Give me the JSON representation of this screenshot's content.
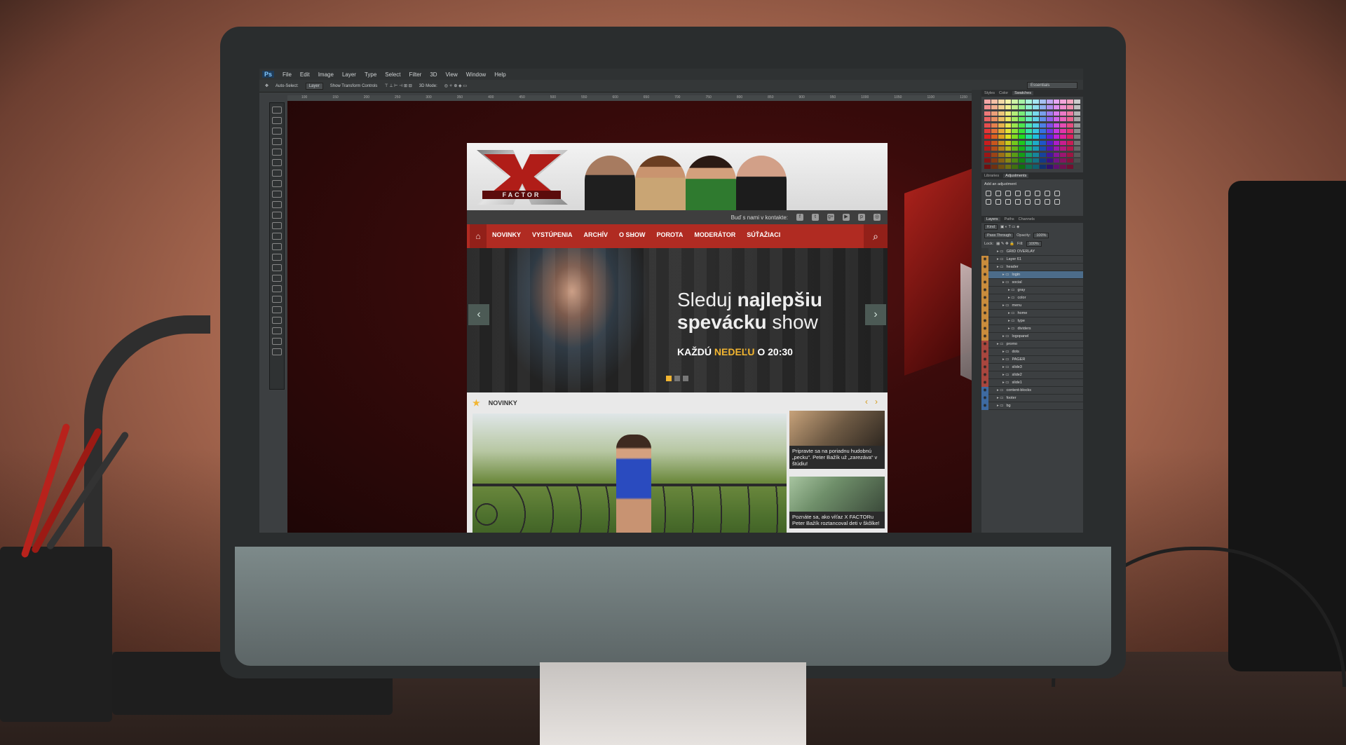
{
  "photoshop": {
    "logo": "Ps",
    "menu": [
      "File",
      "Edit",
      "Image",
      "Layer",
      "Type",
      "Select",
      "Filter",
      "3D",
      "View",
      "Window",
      "Help"
    ],
    "options": {
      "auto_select_label": "Auto-Select:",
      "auto_select_value": "Layer",
      "transform_label": "Show Transform Controls",
      "mode_label": "3D Mode:",
      "workspace": "Essentials"
    },
    "ruler_ticks": [
      "100",
      "150",
      "200",
      "250",
      "300",
      "350",
      "400",
      "450",
      "500",
      "550",
      "600",
      "650",
      "700",
      "750",
      "800",
      "850",
      "900",
      "950",
      "1000",
      "1050",
      "1100",
      "1150"
    ]
  },
  "website": {
    "logo_text": "FACTOR",
    "social_label": "Buď s nami v kontakte:",
    "social_icons": [
      "f",
      "t",
      "g+",
      "▶",
      "p",
      "◎"
    ],
    "nav": [
      "NOVINKY",
      "VYSTÚPENIA",
      "ARCHÍV",
      "O SHOW",
      "POROTA",
      "MODERÁTOR",
      "SÚŤAŽIACI"
    ],
    "hero": {
      "line1_normal": "Sleduj",
      "line1_bold": "najlepšiu",
      "line2_bold": "spevácku",
      "line2_normal": "show",
      "sub_prefix": "KAŽDÚ",
      "sub_highlight": "NEDEĽU",
      "sub_suffix": "O 20:30"
    },
    "news": {
      "title": "NOVINKY",
      "items": [
        {
          "text": "Pripravte sa na poriadnu hudobnú „pecku“. Peter Bažík už „zarezáva“ v štúdiu!"
        },
        {
          "text": "Poznáte sa, ako víťaz X FACTORu Peter Bažík roztancoval deti v škôlke!"
        }
      ]
    }
  },
  "panels": {
    "top_tabs": [
      "Styles",
      "Color",
      "Swatches"
    ],
    "mid_tabs": [
      "Libraries",
      "Adjustments"
    ],
    "adjustments_title": "Add an adjustment",
    "layer_tabs": [
      "Layers",
      "Paths",
      "Channels"
    ],
    "kind_label": "Kind",
    "blend_mode": "Pass Through",
    "opacity_label": "Opacity:",
    "opacity_value": "100%",
    "lock_label": "Lock:",
    "fill_label": "Fill:",
    "fill_value": "100%",
    "layers": [
      {
        "name": "GRID OVERLAY",
        "indent": 0,
        "eye": "none"
      },
      {
        "name": "Layer 61",
        "indent": 0,
        "eye": "orange"
      },
      {
        "name": "header",
        "indent": 0,
        "eye": "orange"
      },
      {
        "name": "login",
        "indent": 1,
        "eye": "orange",
        "selected": true
      },
      {
        "name": "social",
        "indent": 1,
        "eye": "orange"
      },
      {
        "name": "gray",
        "indent": 2,
        "eye": "orange"
      },
      {
        "name": "color",
        "indent": 2,
        "eye": "orange"
      },
      {
        "name": "menu",
        "indent": 1,
        "eye": "orange"
      },
      {
        "name": "home",
        "indent": 2,
        "eye": "orange"
      },
      {
        "name": "type",
        "indent": 2,
        "eye": "orange"
      },
      {
        "name": "dividers",
        "indent": 2,
        "eye": "orange"
      },
      {
        "name": "logopanel",
        "indent": 1,
        "eye": "orange"
      },
      {
        "name": "promo",
        "indent": 0,
        "eye": "red"
      },
      {
        "name": "dots",
        "indent": 1,
        "eye": "red"
      },
      {
        "name": "PAGER",
        "indent": 1,
        "eye": "red"
      },
      {
        "name": "slide3",
        "indent": 1,
        "eye": "red"
      },
      {
        "name": "slide2",
        "indent": 1,
        "eye": "red"
      },
      {
        "name": "slide1",
        "indent": 1,
        "eye": "red"
      },
      {
        "name": "content-blocks",
        "indent": 0,
        "eye": "blue"
      },
      {
        "name": "footer",
        "indent": 0,
        "eye": "blue"
      },
      {
        "name": "bg",
        "indent": 0,
        "eye": "blue"
      }
    ]
  },
  "colors": {
    "nav_red": "#b02b22",
    "accent_yellow": "#f2b531"
  }
}
